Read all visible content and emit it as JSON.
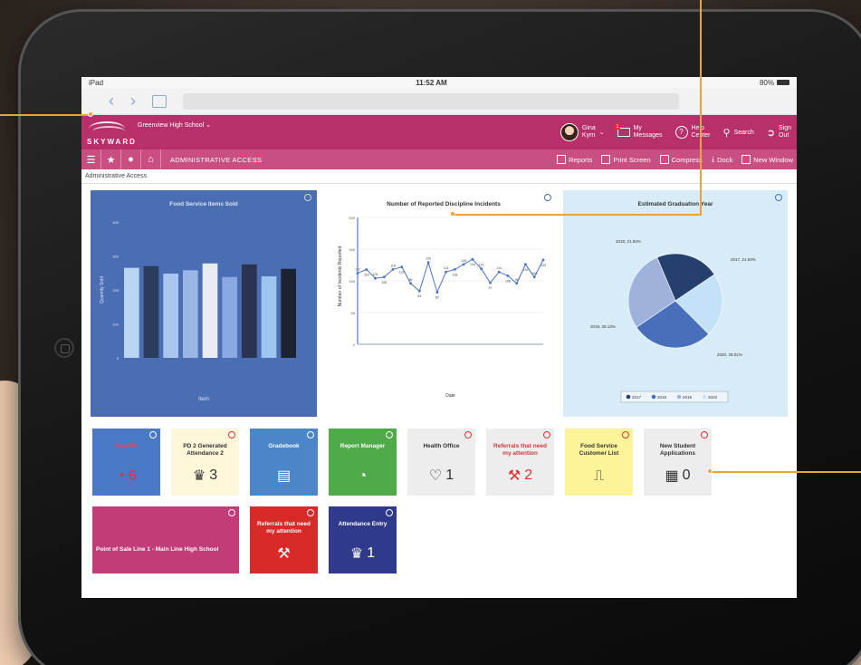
{
  "device": {
    "carrier": "iPad",
    "time": "11:52 AM",
    "battery": "80%"
  },
  "header": {
    "logo_text": "SKYWARD",
    "school": "Greenview High School",
    "user_first": "Gina",
    "user_last": "Kyrn",
    "messages_badge": "1",
    "messages_line1": "My",
    "messages_line2": "Messages",
    "help_line1": "Help",
    "help_line2": "Center",
    "search_label": "Search",
    "signout_line1": "Sign",
    "signout_line2": "Out"
  },
  "navbar": {
    "title": "ADMINISTRATIVE ACCESS",
    "links": [
      "Reports",
      "Print Screen",
      "Compress",
      "Dock",
      "New Window"
    ]
  },
  "breadcrumb": "Administrative Access",
  "charts": {
    "food": {
      "title": "Food Service Items Sold",
      "xlabel": "Item",
      "ylabel": "Quantity Sold"
    },
    "discipline": {
      "title": "Number of Reported Discipline Incidents",
      "xlabel": "Date",
      "ylabel": "Number of Incidents Reported"
    },
    "graduation": {
      "title": "Estimated Graduation Year",
      "legend": [
        "2017",
        "2018",
        "2019",
        "2020"
      ],
      "slice_labels": [
        "2018, 21.93%",
        "2017, 21.93%",
        "2019, 28.13%",
        "2020, 28.01%"
      ]
    }
  },
  "chart_data": [
    {
      "type": "bar",
      "title": "Food Service Items Sold",
      "xlabel": "Item",
      "ylabel": "Quantity Sold",
      "values": [
        265,
        270,
        248,
        258,
        278,
        238,
        275,
        240,
        262
      ],
      "ylim": [
        0,
        400
      ]
    },
    {
      "type": "line",
      "title": "Number of Reported Discipline Incidents",
      "xlabel": "Date",
      "ylabel": "Number of Incidents Reported",
      "values": [
        112,
        118,
        104,
        106,
        118,
        122,
        96,
        84,
        129,
        82,
        114,
        118,
        126,
        134,
        119,
        97,
        114,
        108,
        96,
        126,
        106,
        133
      ],
      "ylim": [
        0,
        200
      ]
    },
    {
      "type": "pie",
      "title": "Estimated Graduation Year",
      "series": [
        {
          "name": "2017",
          "value": 21.93
        },
        {
          "name": "2018",
          "value": 21.93
        },
        {
          "name": "2019",
          "value": 28.13
        },
        {
          "name": "2020",
          "value": 28.01
        }
      ]
    }
  ],
  "tiles": [
    {
      "label": "Reports",
      "value": "6",
      "icon": "pie-chart-icon",
      "color": "#4a79c7"
    },
    {
      "label": "PD 2 Generated Attendance 2",
      "value": "3",
      "icon": "graduate-icon",
      "color": "#fdf6d9"
    },
    {
      "label": "Gradebook",
      "value": "",
      "icon": "grade-book-icon",
      "color": "#4a86c8"
    },
    {
      "label": "Report Manager",
      "value": "",
      "icon": "pie-chart-icon",
      "color": "#4faa4a"
    },
    {
      "label": "Health Office",
      "value": "1",
      "icon": "heart-icon",
      "color": "#ededed"
    },
    {
      "label": "Referrals that need my attention",
      "value": "2",
      "icon": "gavel-icon",
      "color": "#ededed"
    },
    {
      "label": "Food Service Customer List",
      "value": "",
      "icon": "utensils-icon",
      "color": "#fdf49a"
    },
    {
      "label": "New Student Applications",
      "value": "0",
      "icon": "clipboard-icon",
      "color": "#ededed"
    },
    {
      "label": "Point of Sale Line 1 - Main Line High School",
      "value": "",
      "icon": "",
      "color": "#c23c78"
    },
    {
      "label": "Referrals that need my attention",
      "value": "",
      "icon": "gavel-icon",
      "color": "#d92a2a"
    },
    {
      "label": "Attendance Entry",
      "value": "1",
      "icon": "graduate-icon",
      "color": "#2f3b8a"
    }
  ]
}
